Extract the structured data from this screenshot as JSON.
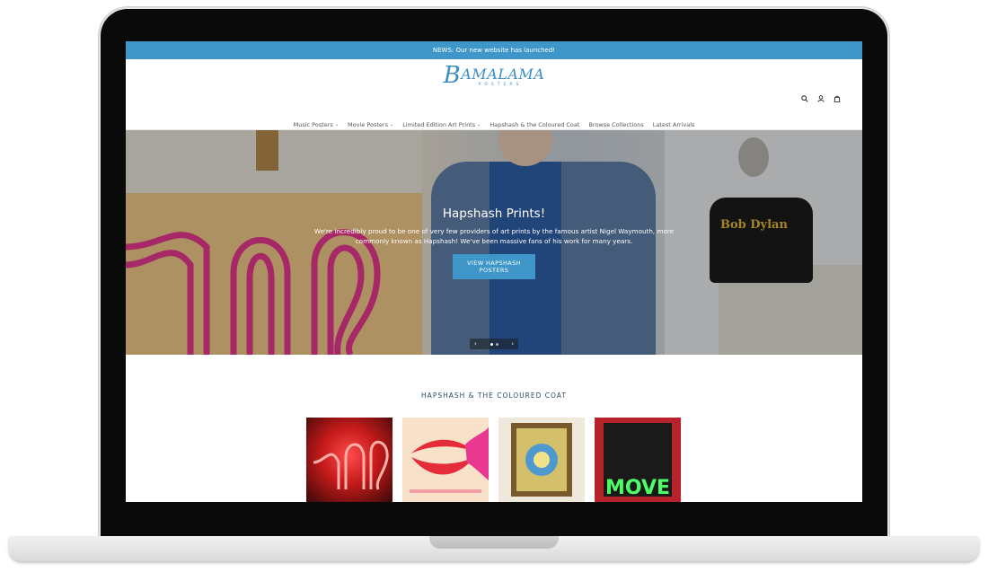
{
  "announcement": {
    "text": "NEWS: Our new website has launched!"
  },
  "logo": {
    "main_initial": "B",
    "main_rest": "AMALAMA",
    "sub": "POSTERS"
  },
  "header_icons": [
    "search-icon",
    "user-icon",
    "cart-icon"
  ],
  "nav": {
    "items": [
      {
        "label": "Music Posters",
        "chevron": "⌄"
      },
      {
        "label": "Movie Posters",
        "chevron": "⌄"
      },
      {
        "label": "Limited Edition Art Prints",
        "chevron": "⌄"
      },
      {
        "label": "Hapshash & the Coloured Coat",
        "chevron": ""
      },
      {
        "label": "Browse Collections",
        "chevron": ""
      },
      {
        "label": "Latest Arrivals",
        "chevron": ""
      }
    ]
  },
  "hero": {
    "title": "Hapshash Prints!",
    "text": "We're incredibly proud to be one of very few providers of art prints by the famous artist Nigel Waymouth, more commonly known as Hapshash! We've been massive fans of his work for many years.",
    "button_label": "VIEW HAPSHASH POSTERS",
    "prev": "‹",
    "next": "›",
    "shirt_text": "Bob Dylan"
  },
  "collection": {
    "title": "HAPSHASH & THE COLOURED COAT",
    "product4_text": "MOVE"
  },
  "colors": {
    "accent": "#3e97c8",
    "title_text": "#2b4a66"
  }
}
